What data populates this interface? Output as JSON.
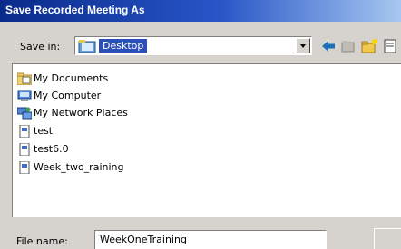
{
  "dialog": {
    "title": "Save Recorded Meeting As"
  },
  "save_in": {
    "label": "Save in:",
    "value": "Desktop"
  },
  "files": [
    {
      "label": "My Documents",
      "icon": "my-documents-icon"
    },
    {
      "label": "My Computer",
      "icon": "my-computer-icon"
    },
    {
      "label": "My Network Places",
      "icon": "network-places-icon"
    },
    {
      "label": "test",
      "icon": "file-icon"
    },
    {
      "label": "test6.0",
      "icon": "file-icon"
    },
    {
      "label": "Week_two_raining",
      "icon": "file-icon"
    }
  ],
  "file_name": {
    "label": "File name:",
    "value": "WeekOneTraining"
  }
}
